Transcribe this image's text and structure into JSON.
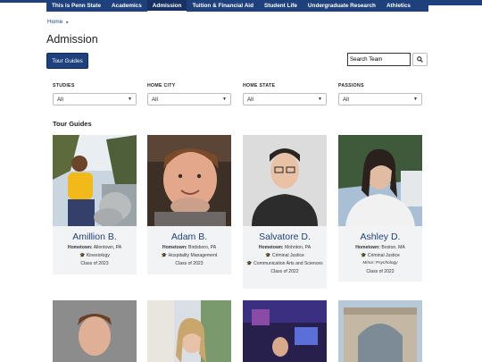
{
  "nav": {
    "items": [
      "This is Penn State",
      "Academics",
      "Admission",
      "Tuition & Financial Aid",
      "Student Life",
      "Undergraduate Research",
      "Athletics"
    ],
    "active_index": 2
  },
  "breadcrumb": {
    "home": "Home",
    "separator": "▸"
  },
  "page": {
    "title": "Admission"
  },
  "toolbar": {
    "tour_guides_label": "Tour Guides",
    "search_value": "Search Team",
    "search_icon": "search-icon"
  },
  "filters": [
    {
      "label": "STUDIES",
      "value": "All"
    },
    {
      "label": "HOME CITY",
      "value": "All"
    },
    {
      "label": "HOME STATE",
      "value": "All"
    },
    {
      "label": "PASSIONS",
      "value": "All"
    }
  ],
  "section": {
    "title": "Tour Guides"
  },
  "guides": [
    {
      "name": "Amillion B.",
      "hometown_label": "Hometown:",
      "hometown": "Allentown, PA",
      "major": "Kinesiology",
      "extra": "",
      "minor": "",
      "class_year": "Class of 2023"
    },
    {
      "name": "Adam B.",
      "hometown_label": "Hometown:",
      "hometown": "Birdsboro, PA",
      "major": "Hospitality Management",
      "extra": "",
      "minor": "",
      "class_year": "Class of 2023"
    },
    {
      "name": "Salvatore D.",
      "hometown_label": "Hometown:",
      "hometown": "Mohnton, PA",
      "major": "Criminal Justice",
      "extra": "Communication Arts and Sciences",
      "minor": "",
      "class_year": "Class of 2022"
    },
    {
      "name": "Ashley D.",
      "hometown_label": "Hometown:",
      "hometown": "Boston, MA",
      "major": "Criminal Justice",
      "extra": "",
      "minor": "Minor: Psychology",
      "class_year": "Class of 2022"
    }
  ],
  "colors": {
    "brand": "#1e407c",
    "card_bg": "#f2f3f4"
  }
}
